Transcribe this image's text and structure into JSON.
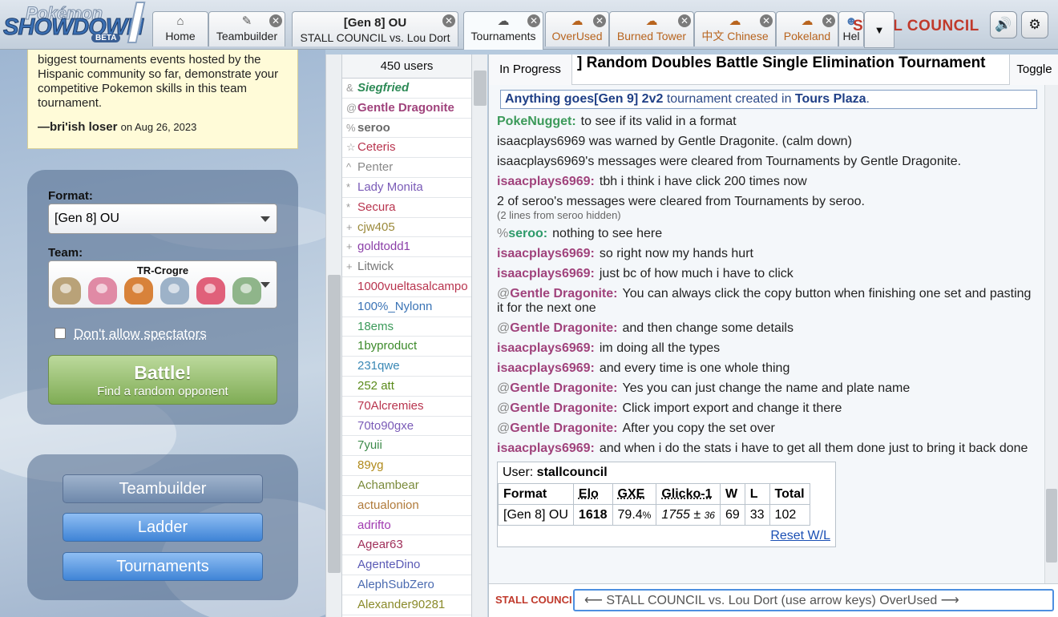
{
  "header": {
    "logo_top": "Pokémon",
    "logo_main": "SHOWDOWN",
    "logo_badge": "BETA",
    "tabs": [
      {
        "icon": "⌂",
        "label": "Home"
      },
      {
        "icon": "✎",
        "label": "Teambuilder"
      },
      {
        "line1": "[Gen 8] OU",
        "line2": "STALL COUNCIL vs. Lou Dort"
      },
      {
        "icon": "☁",
        "label": "Tournaments"
      },
      {
        "icon": "☁",
        "label": "OverUsed"
      },
      {
        "icon": "☁",
        "label": "Burned Tower"
      },
      {
        "icon": "☁",
        "label": "中文 Chinese"
      },
      {
        "icon": "☁",
        "label": "Pokeland"
      },
      {
        "icon": "☻",
        "label": "Hel"
      }
    ],
    "close_glyph": "✕",
    "more_glyph": "▼",
    "username": "STALL COUNCIL",
    "sound_glyph": "🔊",
    "settings_glyph": "⚙"
  },
  "mainmenu": {
    "quote": {
      "text": "biggest tournaments events hosted by the Hispanic community so far, demonstrate your competitive Pokemon skills in this team tournament.",
      "author": "—bri'ish loser",
      "date": "on Aug 26, 2023"
    },
    "format_label": "Format:",
    "format_value": "[Gen 8] OU",
    "team_label": "Team:",
    "team_name": "TR-Crogre",
    "spectators_label": "Don't allow spectators",
    "battle_title": "Battle!",
    "battle_subtitle": "Find a random opponent",
    "buttons": {
      "teambuilder": "Teambuilder",
      "ladder": "Ladder",
      "tournaments": "Tournaments"
    }
  },
  "userlist": {
    "count": "450 users",
    "users": [
      {
        "rank": "&",
        "name": "Siegfried",
        "color": "#2e8b57",
        "style": "bolditalic"
      },
      {
        "rank": "@",
        "name": "Gentle Dragonite",
        "color": "#a0437c",
        "style": "bold"
      },
      {
        "rank": "%",
        "name": "seroo",
        "color": "#6a6a6a",
        "style": "bold"
      },
      {
        "rank": "☆",
        "name": "Ceteris",
        "color": "#b8344e",
        "style": "normal"
      },
      {
        "rank": "^",
        "name": "Penter",
        "color": "#888888",
        "style": "normal"
      },
      {
        "rank": "*",
        "name": "Lady Monita",
        "color": "#7a5bb7",
        "style": "normal"
      },
      {
        "rank": "*",
        "name": "Secura",
        "color": "#b8344e",
        "style": "normal"
      },
      {
        "rank": "+",
        "name": "cjw405",
        "color": "#9b8a3c",
        "style": "normal"
      },
      {
        "rank": "+",
        "name": "goldtodd1",
        "color": "#8b3fa8",
        "style": "normal"
      },
      {
        "rank": "+",
        "name": "Litwick",
        "color": "#777777",
        "style": "normal"
      },
      {
        "rank": "",
        "name": "1000vueltasalcampo",
        "color": "#b8344e",
        "style": "normal"
      },
      {
        "rank": "",
        "name": "100%_Nylonn",
        "color": "#3a73b5",
        "style": "normal"
      },
      {
        "rank": "",
        "name": "18ems",
        "color": "#3c9a5a",
        "style": "normal"
      },
      {
        "rank": "",
        "name": "1byproduct",
        "color": "#3c8a2a",
        "style": "normal"
      },
      {
        "rank": "",
        "name": "231qwe",
        "color": "#3a88b5",
        "style": "normal"
      },
      {
        "rank": "",
        "name": "252 att",
        "color": "#5a8a1a",
        "style": "normal"
      },
      {
        "rank": "",
        "name": "70Alcremies",
        "color": "#b8344e",
        "style": "normal"
      },
      {
        "rank": "",
        "name": "70to90gxe",
        "color": "#7a5bb7",
        "style": "normal"
      },
      {
        "rank": "",
        "name": "7yuii",
        "color": "#3c8a4a",
        "style": "normal"
      },
      {
        "rank": "",
        "name": "89yg",
        "color": "#b08a1a",
        "style": "normal"
      },
      {
        "rank": "",
        "name": "Achambear",
        "color": "#7a8a3a",
        "style": "normal"
      },
      {
        "rank": "",
        "name": "actualonion",
        "color": "#b07a3a",
        "style": "normal"
      },
      {
        "rank": "",
        "name": "adrifto",
        "color": "#a03ab0",
        "style": "normal"
      },
      {
        "rank": "",
        "name": "Agear63",
        "color": "#a0305a",
        "style": "normal"
      },
      {
        "rank": "",
        "name": "AgenteDino",
        "color": "#5a5ab5",
        "style": "normal"
      },
      {
        "rank": "",
        "name": "AlephSubZero",
        "color": "#4a6ab0",
        "style": "normal"
      },
      {
        "rank": "",
        "name": "Alexander90281",
        "color": "#8a8a2a",
        "style": "normal"
      }
    ]
  },
  "chat": {
    "in_progress_label": "In Progress",
    "title": "] Random Doubles Battle Single Elimination Tournament",
    "toggle_label": "Toggle",
    "announce_prefix": "Anything goes[Gen 9] 2v2",
    "announce_middle": " tournament created in ",
    "announce_room": "Tours Plaza",
    "announce_suffix": ".",
    "messages": [
      {
        "rank": "",
        "user": "PokeNugget:",
        "color": "#3c9a5a",
        "text": "to see if its valid in a format"
      },
      {
        "notice": "isaacplays6969 was warned by Gentle Dragonite. (calm down)"
      },
      {
        "notice": "isaacplays6969's messages were cleared from Tournaments by Gentle Dragonite."
      },
      {
        "rank": "",
        "user": "isaacplays6969:",
        "color": "#a0437c",
        "text": "tbh i think i have click 200 times now"
      },
      {
        "notice": "2 of seroo's messages were cleared from Tournaments by seroo.",
        "note": "(2 lines from seroo hidden)"
      },
      {
        "rank": "%",
        "user": "seroo:",
        "color": "#2e9a6a",
        "text": "nothing to see here"
      },
      {
        "rank": "",
        "user": "isaacplays6969:",
        "color": "#a0437c",
        "text": "so right now my hands hurt"
      },
      {
        "rank": "",
        "user": "isaacplays6969:",
        "color": "#a0437c",
        "text": "just bc of how much i have to click"
      },
      {
        "rank": "@",
        "user": "Gentle Dragonite:",
        "color": "#a0437c",
        "text": "You can always click the copy button when finishing one set and pasting it for the next one"
      },
      {
        "rank": "@",
        "user": "Gentle Dragonite:",
        "color": "#a0437c",
        "text": "and then change some details"
      },
      {
        "rank": "",
        "user": "isaacplays6969:",
        "color": "#a0437c",
        "text": "im doing all the types"
      },
      {
        "rank": "",
        "user": "isaacplays6969:",
        "color": "#a0437c",
        "text": "and every time is one whole thing"
      },
      {
        "rank": "@",
        "user": "Gentle Dragonite:",
        "color": "#a0437c",
        "text": "Yes you can just change the name and plate name"
      },
      {
        "rank": "@",
        "user": "Gentle Dragonite:",
        "color": "#a0437c",
        "text": "Click import export and change it there"
      },
      {
        "rank": "@",
        "user": "Gentle Dragonite:",
        "color": "#a0437c",
        "text": "After you copy the set over"
      },
      {
        "rank": "",
        "user": "isaacplays6969:",
        "color": "#a0437c",
        "text": "and when i do the stats i have to get all them done just to bring it back done"
      }
    ],
    "stats": {
      "user_label": "User: ",
      "user": "stallcouncil",
      "headers": [
        "Format",
        "Elo",
        "GXE",
        "Glicko-1",
        "W",
        "L",
        "Total"
      ],
      "row": {
        "format": "[Gen 8] OU",
        "elo": "1618",
        "gxe": "79.4",
        "gxe_unit": "%",
        "glicko": "1755",
        "glicko_pm": " ± ",
        "glicko_dev": "36",
        "w": "69",
        "l": "33",
        "total": "102"
      },
      "reset": "Reset W/L"
    },
    "chatbox_user": "STALL COUNCIL",
    "input_value": "⟵ STALL COUNCIL vs. Lou Dort (use arrow keys) OverUsed ⟶"
  }
}
